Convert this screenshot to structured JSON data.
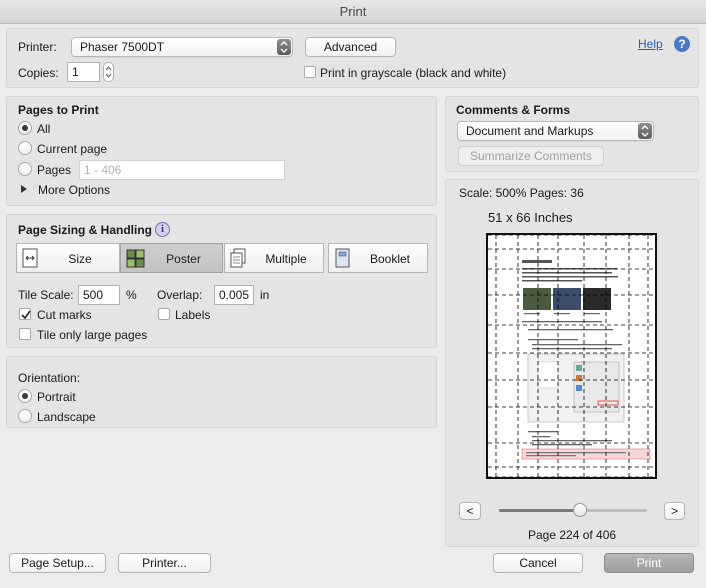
{
  "window": {
    "title": "Print"
  },
  "printer": {
    "label": "Printer:",
    "value": "Phaser 7500DT",
    "advanced": "Advanced",
    "help": "Help",
    "copies_label": "Copies:",
    "copies_value": "1",
    "grayscale": "Print in grayscale (black and white)"
  },
  "pages_to_print": {
    "title": "Pages to Print",
    "all": "All",
    "current": "Current page",
    "pages": "Pages",
    "pages_placeholder": "1 - 406",
    "more_options": "More Options"
  },
  "sizing": {
    "title": "Page Sizing & Handling",
    "buttons": [
      "Size",
      "Poster",
      "Multiple",
      "Booklet"
    ],
    "tile_scale_label": "Tile Scale:",
    "tile_scale_value": "500",
    "percent": "%",
    "overlap_label": "Overlap:",
    "overlap_value": "0.005",
    "overlap_unit": "in",
    "cut_marks": "Cut marks",
    "labels": "Labels",
    "tile_only_large": "Tile only large pages"
  },
  "orientation": {
    "title": "Orientation:",
    "portrait": "Portrait",
    "landscape": "Landscape"
  },
  "comments": {
    "title": "Comments & Forms",
    "value": "Document and Markups",
    "summarize": "Summarize Comments"
  },
  "preview": {
    "scale_text": "Scale: 500% Pages: 36",
    "size_text": "51 x 66 Inches",
    "prev": "<",
    "next": ">",
    "page_text": "Page 224 of 406",
    "slider_fraction": 0.55
  },
  "footer": {
    "page_setup": "Page Setup...",
    "printer": "Printer...",
    "cancel": "Cancel",
    "print": "Print"
  }
}
